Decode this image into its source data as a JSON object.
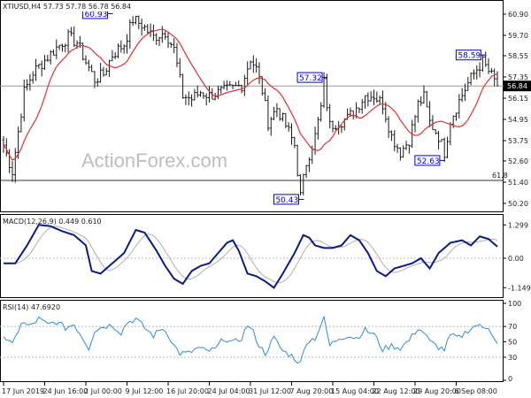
{
  "chart_data": [
    {
      "type": "candlestick",
      "header": "XTIUSD,H4  57.73 57.78 56.78 56.84",
      "watermark": "ActionForex.com",
      "y_ticks": [
        "60.90",
        "59.70",
        "58.55",
        "57.35",
        "56.15",
        "54.95",
        "53.75",
        "52.60",
        "51.40",
        "50.20"
      ],
      "y_tick_values": [
        60.9,
        59.7,
        58.55,
        57.35,
        56.15,
        54.95,
        53.75,
        52.6,
        51.4,
        50.2
      ],
      "ylim": [
        49.9,
        61.5
      ],
      "current_price": "56.84",
      "current_price_value": 56.84,
      "reference_line": {
        "label": "61.8",
        "value": 51.5
      },
      "annotations": [
        {
          "label": "60.93",
          "value": 60.93,
          "bar": 36
        },
        {
          "label": "57.32",
          "value": 57.32,
          "bar": 109
        },
        {
          "label": "50.43",
          "value": 50.43,
          "bar": 101
        },
        {
          "label": "58.59",
          "value": 58.59,
          "bar": 163
        },
        {
          "label": "52.63",
          "value": 52.63,
          "bar": 149
        }
      ],
      "close_keypoints": [
        [
          0,
          53.5
        ],
        [
          3,
          52.0
        ],
        [
          7,
          56.5
        ],
        [
          10,
          57.6
        ],
        [
          14,
          58.3
        ],
        [
          18,
          59.0
        ],
        [
          22,
          59.6
        ],
        [
          25,
          59.3
        ],
        [
          28,
          58.2
        ],
        [
          31,
          57.2
        ],
        [
          34,
          57.5
        ],
        [
          37,
          58.6
        ],
        [
          41,
          59.2
        ],
        [
          44,
          60.6
        ],
        [
          47,
          60.3
        ],
        [
          51,
          59.6
        ],
        [
          55,
          59.9
        ],
        [
          58,
          58.9
        ],
        [
          61,
          56.3
        ],
        [
          64,
          56.1
        ],
        [
          67,
          56.5
        ],
        [
          70,
          56.3
        ],
        [
          74,
          56.5
        ],
        [
          78,
          56.7
        ],
        [
          81,
          56.9
        ],
        [
          84,
          58.4
        ],
        [
          86,
          57.8
        ],
        [
          88,
          56.6
        ],
        [
          90,
          54.8
        ],
        [
          93,
          55.6
        ],
        [
          96,
          54.6
        ],
        [
          99,
          53.5
        ],
        [
          101,
          50.6
        ],
        [
          103,
          52.5
        ],
        [
          106,
          54.0
        ],
        [
          108,
          55.6
        ],
        [
          109,
          57.0
        ],
        [
          111,
          54.6
        ],
        [
          114,
          54.8
        ],
        [
          117,
          55.0
        ],
        [
          120,
          55.6
        ],
        [
          123,
          56.3
        ],
        [
          126,
          56.3
        ],
        [
          129,
          55.8
        ],
        [
          132,
          54.0
        ],
        [
          135,
          53.1
        ],
        [
          138,
          53.8
        ],
        [
          141,
          55.8
        ],
        [
          143,
          56.2
        ],
        [
          145,
          54.8
        ],
        [
          148,
          54.0
        ],
        [
          150,
          53.1
        ],
        [
          152,
          54.9
        ],
        [
          155,
          56.0
        ],
        [
          158,
          57.0
        ],
        [
          161,
          57.8
        ],
        [
          163,
          58.2
        ],
        [
          166,
          57.4
        ],
        [
          168,
          56.84
        ]
      ],
      "x_tick_labels": [
        "17 Jun 2019",
        "24 Jun 16:00",
        "2 Jul 00:00",
        "9 Jul 12:00",
        "16 Jul 20:00",
        "24 Jul 04:00",
        "31 Jul 12:00",
        "7 Aug 20:00",
        "15 Aug 04:00",
        "22 Aug 12:00",
        "29 Aug 20:00",
        "6 Sep 08:00"
      ],
      "x_tick_bars": [
        0,
        14,
        28,
        42,
        56,
        70,
        84,
        98,
        112,
        126,
        140,
        154
      ],
      "series": [
        {
          "name": "price",
          "color": "#1a1a1a"
        },
        {
          "name": "moving_average",
          "color": "#e03030"
        }
      ]
    },
    {
      "type": "line",
      "header": "MACD(12,26,9)  0.449  0.610",
      "y_ticks": [
        "1.299",
        "0.00",
        "-1.149"
      ],
      "y_tick_values": [
        1.299,
        0.0,
        -1.149
      ],
      "ylim": [
        -1.45,
        1.55
      ],
      "macd_keypoints": [
        [
          0,
          -0.2
        ],
        [
          4,
          -0.2
        ],
        [
          8,
          0.5
        ],
        [
          12,
          1.3
        ],
        [
          16,
          1.25
        ],
        [
          20,
          1.05
        ],
        [
          24,
          0.9
        ],
        [
          28,
          0.5
        ],
        [
          30,
          -0.5
        ],
        [
          33,
          -0.6
        ],
        [
          37,
          -0.2
        ],
        [
          41,
          0.2
        ],
        [
          45,
          1.1
        ],
        [
          48,
          1.0
        ],
        [
          52,
          0.3
        ],
        [
          55,
          -0.3
        ],
        [
          58,
          -0.8
        ],
        [
          61,
          -1.0
        ],
        [
          64,
          -0.5
        ],
        [
          67,
          -0.3
        ],
        [
          70,
          -0.2
        ],
        [
          73,
          0.2
        ],
        [
          76,
          0.6
        ],
        [
          78,
          0.7
        ],
        [
          80,
          0.3
        ],
        [
          83,
          -0.6
        ],
        [
          86,
          -0.7
        ],
        [
          89,
          -0.9
        ],
        [
          92,
          -1.15
        ],
        [
          95,
          -0.6
        ],
        [
          99,
          0.2
        ],
        [
          102,
          0.9
        ],
        [
          104,
          0.8
        ],
        [
          106,
          0.5
        ],
        [
          109,
          0.4
        ],
        [
          112,
          0.4
        ],
        [
          115,
          0.5
        ],
        [
          118,
          0.9
        ],
        [
          121,
          0.7
        ],
        [
          124,
          0.2
        ],
        [
          127,
          -0.5
        ],
        [
          130,
          -0.7
        ],
        [
          133,
          -0.4
        ],
        [
          136,
          -0.3
        ],
        [
          139,
          -0.2
        ],
        [
          142,
          0.0
        ],
        [
          145,
          -0.4
        ],
        [
          148,
          0.2
        ],
        [
          152,
          0.6
        ],
        [
          156,
          0.7
        ],
        [
          159,
          0.5
        ],
        [
          162,
          0.85
        ],
        [
          165,
          0.75
        ],
        [
          168,
          0.45
        ]
      ],
      "signal_lag": 3,
      "series": [
        {
          "name": "macd",
          "color": "#0a1a88"
        },
        {
          "name": "signal",
          "color": "#b0b0b0"
        }
      ]
    },
    {
      "type": "line",
      "header": "RSI(14)  47.6920",
      "y_ticks": [
        "100",
        "70",
        "50",
        "30",
        "0"
      ],
      "y_tick_values": [
        100,
        70,
        50,
        30,
        0
      ],
      "ylim": [
        0,
        100
      ],
      "rsi_keypoints": [
        [
          0,
          58
        ],
        [
          3,
          45
        ],
        [
          6,
          75
        ],
        [
          9,
          70
        ],
        [
          12,
          80
        ],
        [
          15,
          72
        ],
        [
          18,
          76
        ],
        [
          21,
          68
        ],
        [
          24,
          73
        ],
        [
          27,
          55
        ],
        [
          29,
          42
        ],
        [
          31,
          65
        ],
        [
          34,
          70
        ],
        [
          37,
          72
        ],
        [
          40,
          62
        ],
        [
          42,
          75
        ],
        [
          45,
          80
        ],
        [
          48,
          68
        ],
        [
          51,
          58
        ],
        [
          54,
          68
        ],
        [
          56,
          60
        ],
        [
          58,
          45
        ],
        [
          60,
          35
        ],
        [
          63,
          35
        ],
        [
          66,
          42
        ],
        [
          69,
          38
        ],
        [
          72,
          40
        ],
        [
          75,
          55
        ],
        [
          78,
          48
        ],
        [
          81,
          55
        ],
        [
          83,
          72
        ],
        [
          85,
          62
        ],
        [
          87,
          45
        ],
        [
          89,
          35
        ],
        [
          92,
          55
        ],
        [
          95,
          38
        ],
        [
          98,
          32
        ],
        [
          101,
          22
        ],
        [
          103,
          50
        ],
        [
          106,
          55
        ],
        [
          108,
          72
        ],
        [
          109,
          80
        ],
        [
          111,
          45
        ],
        [
          114,
          55
        ],
        [
          117,
          58
        ],
        [
          120,
          55
        ],
        [
          123,
          65
        ],
        [
          126,
          60
        ],
        [
          129,
          40
        ],
        [
          132,
          45
        ],
        [
          135,
          42
        ],
        [
          138,
          52
        ],
        [
          141,
          68
        ],
        [
          143,
          62
        ],
        [
          145,
          50
        ],
        [
          148,
          43
        ],
        [
          150,
          40
        ],
        [
          152,
          58
        ],
        [
          155,
          55
        ],
        [
          158,
          65
        ],
        [
          161,
          72
        ],
        [
          163,
          68
        ],
        [
          165,
          70
        ],
        [
          168,
          47.692
        ]
      ],
      "series": [
        {
          "name": "rsi",
          "color": "#2e8cd8"
        }
      ]
    }
  ]
}
